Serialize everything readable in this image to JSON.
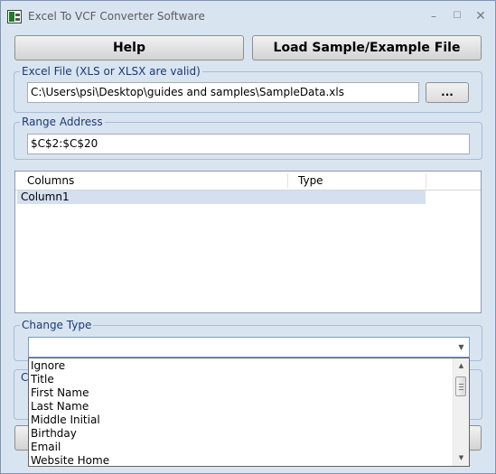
{
  "window": {
    "title": "Excel To VCF Converter Software",
    "min_glyph": "–",
    "max_glyph": "☐",
    "close_glyph": "✕"
  },
  "toolbar": {
    "help_label": "Help",
    "load_label": "Load Sample/Example File"
  },
  "excel_file": {
    "legend": "Excel File (XLS or XLSX are valid)",
    "value": "C:\\Users\\psi\\Desktop\\guides and samples\\SampleData.xls",
    "browse_label": "..."
  },
  "range": {
    "legend": "Range Address",
    "value": "$C$2:$C$20"
  },
  "columns_table": {
    "headers": [
      "Columns",
      "Type"
    ],
    "rows": [
      {
        "column": "Column1",
        "type": ""
      }
    ]
  },
  "change_type": {
    "legend": "Change Type",
    "selected": "",
    "options": [
      "Ignore",
      "Title",
      "First Name",
      "Last Name",
      "Middle Initial",
      "Birthday",
      "Email",
      "Website Home"
    ]
  },
  "ghost": {
    "letter": "C"
  },
  "icons": {
    "combo_arrow": "▼",
    "scroll_up": "▲",
    "scroll_down": "▼"
  }
}
